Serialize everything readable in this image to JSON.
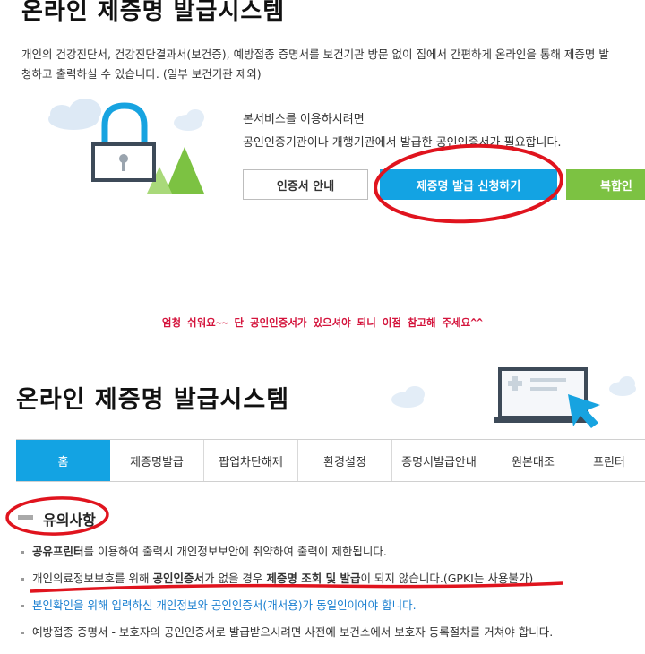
{
  "section1": {
    "title": "온라인 제증명 발급시스템",
    "desc_line1": "개인의 건강진단서, 건강진단결과서(보건증), 예방접종 증명서를 보건기관 방문 없이 집에서 간편하게 온라인을 통해 제증명 발",
    "desc_line2": "청하고 출력하실 수 있습니다. (일부 보건기관 제외)",
    "service_line1": "본서비스를 이용하시려면",
    "service_line2": "공인인증기관이나 개행기관에서 발급한 공인인증서가 필요합니다.",
    "buttons": {
      "cert_guide": "인증서 안내",
      "apply": "제증명 발급 신청하기",
      "combo": "복합인"
    }
  },
  "annotation_note": "엄청 쉬워요~~ 단 공인인증서가 있으셔야 되니 이점 참고해 주세요^^",
  "section2": {
    "title": "온라인 제증명 발급시스템",
    "tabs": [
      "홈",
      "제증명발급",
      "팝업차단해제",
      "환경설정",
      "증명서발급안내",
      "원본대조",
      "프린터"
    ],
    "active_tab": "홈",
    "notice_title": "유의사항",
    "bullets": [
      {
        "pre": "공유프린터",
        "text": "를 이용하여 출력시 개인정보보안에 취약하여 출력이 제한됩니다."
      },
      {
        "text_a": "개인의료정보보호를 위해 ",
        "bold_a": "공인인증서",
        "text_b": "가 없을 경우 ",
        "bold_b": "제증명 조회 및 발급",
        "text_c": "이 되지 않습니다.(GPKI는 사용불가)"
      },
      {
        "text": "본인확인을 위해 입력하신 개인정보와 공인인증서(개서용)가 동일인이어야 합니다."
      },
      {
        "text": "예방접종 증명서 - 보호자의 공인인증서로 발급받으시려면 사전에 보건소에서 보호자 등록절차를 거쳐야 합니다."
      }
    ]
  },
  "colors": {
    "accent_blue": "#13a3e3",
    "accent_green": "#7cc242",
    "annotation_red": "#e0141e"
  }
}
